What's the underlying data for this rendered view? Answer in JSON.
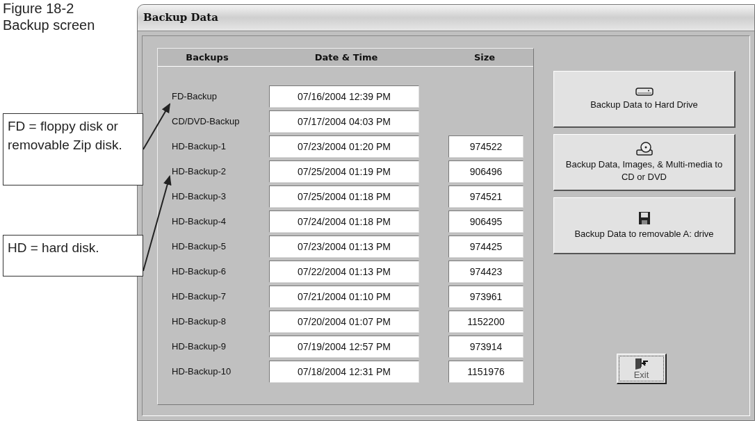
{
  "caption": [
    "Figure 18-2",
    "Backup screen"
  ],
  "window": {
    "title": "Backup Data"
  },
  "table": {
    "columns": [
      "Backups",
      "Date & Time",
      "Size"
    ],
    "rows": [
      {
        "name": "FD-Backup",
        "date": "07/16/2004 12:39 PM"
      },
      {
        "name": "CD/DVD-Backup",
        "date": "07/17/2004 04:03 PM"
      },
      {
        "name": "HD-Backup-1",
        "date": "07/23/2004 01:20 PM",
        "size": "974522"
      },
      {
        "name": "HD-Backup-2",
        "date": "07/25/2004 01:19 PM",
        "size": "906496"
      },
      {
        "name": "HD-Backup-3",
        "date": "07/25/2004 01:18 PM",
        "size": "974521"
      },
      {
        "name": "HD-Backup-4",
        "date": "07/24/2004 01:18 PM",
        "size": "906495"
      },
      {
        "name": "HD-Backup-5",
        "date": "07/23/2004 01:13 PM",
        "size": "974425"
      },
      {
        "name": "HD-Backup-6",
        "date": "07/22/2004 01:13 PM",
        "size": "974423"
      },
      {
        "name": "HD-Backup-7",
        "date": "07/21/2004 01:10 PM",
        "size": "973961"
      },
      {
        "name": "HD-Backup-8",
        "date": "07/20/2004 01:07 PM",
        "size": "1152200"
      },
      {
        "name": "HD-Backup-9",
        "date": "07/19/2004 12:57 PM",
        "size": "973914"
      },
      {
        "name": "HD-Backup-10",
        "date": "07/18/2004 12:31 PM",
        "size": "1151976"
      }
    ]
  },
  "actions": [
    {
      "kind": "harddrive",
      "label": "Backup Data to Hard Drive"
    },
    {
      "kind": "cd",
      "label": "Backup Data, Images, & Multi-media to CD or DVD"
    },
    {
      "kind": "floppy",
      "label": "Backup Data to removable A: drive"
    }
  ],
  "exit": {
    "label": "Exit"
  },
  "callouts": [
    {
      "text": "FD = floppy disk or removable Zip disk."
    },
    {
      "text": "HD = hard disk."
    }
  ]
}
